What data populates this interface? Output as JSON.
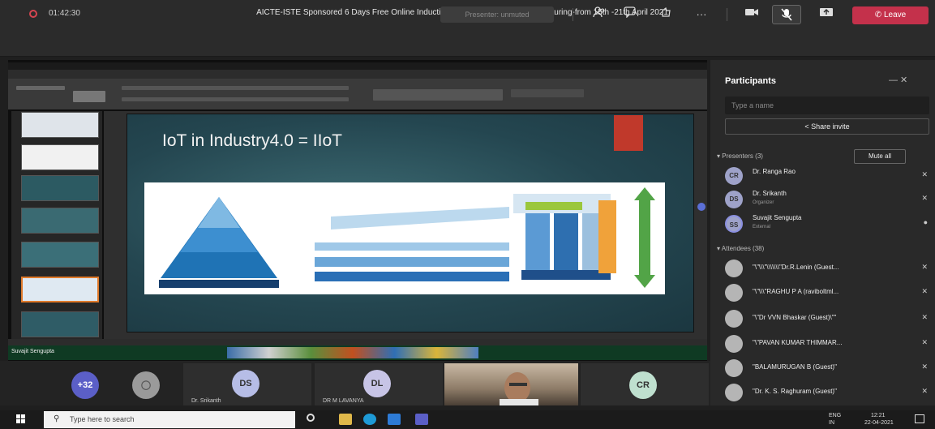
{
  "window": {
    "title": "AICTE-ISTE Sponsored 6 Days Free Online Induction Program on IOT in Manufacturing-from 15th -21th April 2021",
    "minimize": "—",
    "maximize": "☐",
    "close": "✕"
  },
  "call": {
    "timer": "01:42:30",
    "presenting_label": "Presenter: unmuted",
    "leave_label": "Leave",
    "colors": {
      "leave": "#c4314b",
      "record": "#d64550"
    }
  },
  "slide": {
    "title": "IoT in Industry4.0 = IIoT",
    "presenter_tag": "Suvajit Sengupta"
  },
  "participants": {
    "title": "Participants",
    "search_placeholder": "Type a name",
    "share_invite": "Share invite",
    "presenters_header": "Presenters (3)",
    "mute_all": "Mute all",
    "presenters": [
      {
        "initials": "CR",
        "name": "Dr. Ranga Rao",
        "sub": ""
      },
      {
        "initials": "DS",
        "name": "Dr. Srikanth",
        "sub": "Organizer"
      },
      {
        "initials": "SS",
        "name": "Suvajit Sengupta",
        "sub": "External"
      }
    ],
    "attendees_header": "Attendees (38)",
    "attendees": [
      {
        "name": "\"\\\"\\\\\\\"\\\\\\\\\\\\\\\"Dr.R.Lenin (Guest..."
      },
      {
        "name": "\"\\\"\\\\\\\"RAGHU P A (raviboltml..."
      },
      {
        "name": "\"\\\"Dr VVN Bhaskar (Guest)\\\"\""
      },
      {
        "name": "\"\\\"PAVAN KUMAR THIMMAR..."
      },
      {
        "name": "\"BALAMURUGAN B (Guest)\""
      },
      {
        "name": "\"Dr. K. S. Raghuram (Guest)\""
      }
    ]
  },
  "strip": {
    "overflow": "+32",
    "tiles": [
      {
        "initials": "DS",
        "name": "Dr. Srikanth"
      },
      {
        "initials": "DL",
        "name": "DR M LAVANYA"
      },
      {
        "initials": "CR",
        "name": ""
      }
    ]
  },
  "taskbar": {
    "search_placeholder": "Type here to search",
    "lang": "ENG",
    "region": "IN",
    "time": "12:21",
    "date": "22-04-2021"
  }
}
